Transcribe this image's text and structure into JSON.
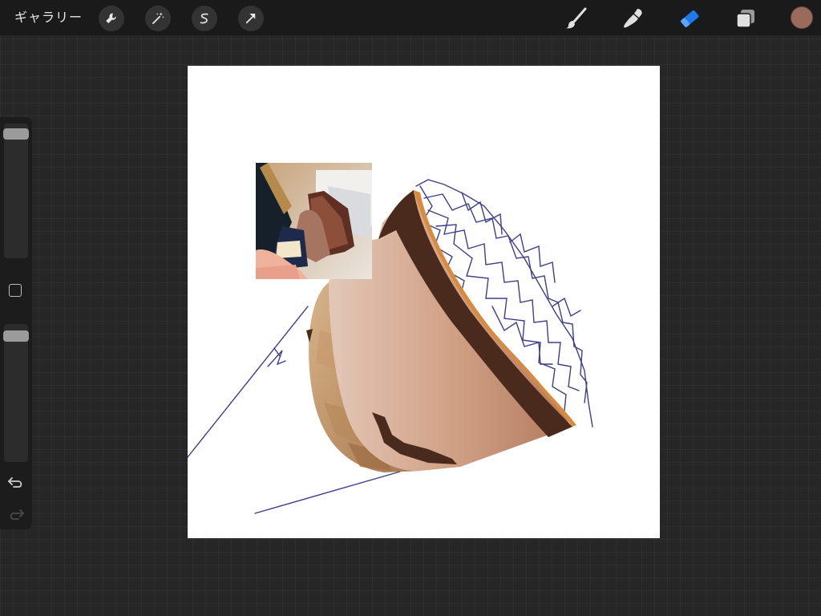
{
  "toolbar": {
    "gallery_label": "ギャラリー",
    "left_tools": [
      "wrench-icon",
      "magic-wand-icon",
      "selection-icon",
      "transform-arrow-icon"
    ],
    "right_tools": [
      "brush-icon",
      "smudge-icon",
      "eraser-icon",
      "layers-icon"
    ],
    "active_tool": "eraser-icon",
    "active_color": "#9a6a5c",
    "accent_color": "#1e7ae8"
  },
  "sidebar": {
    "brush_size_level": 0.04,
    "opacity_level": 0.05,
    "controls": [
      "modify-square-icon",
      "undo-icon",
      "redo-icon"
    ]
  },
  "canvas": {
    "background": "#ffffff",
    "layers_description_items": [
      "reference-photo",
      "painted-ice-cream-cone",
      "pencil-sketch-lines"
    ]
  }
}
